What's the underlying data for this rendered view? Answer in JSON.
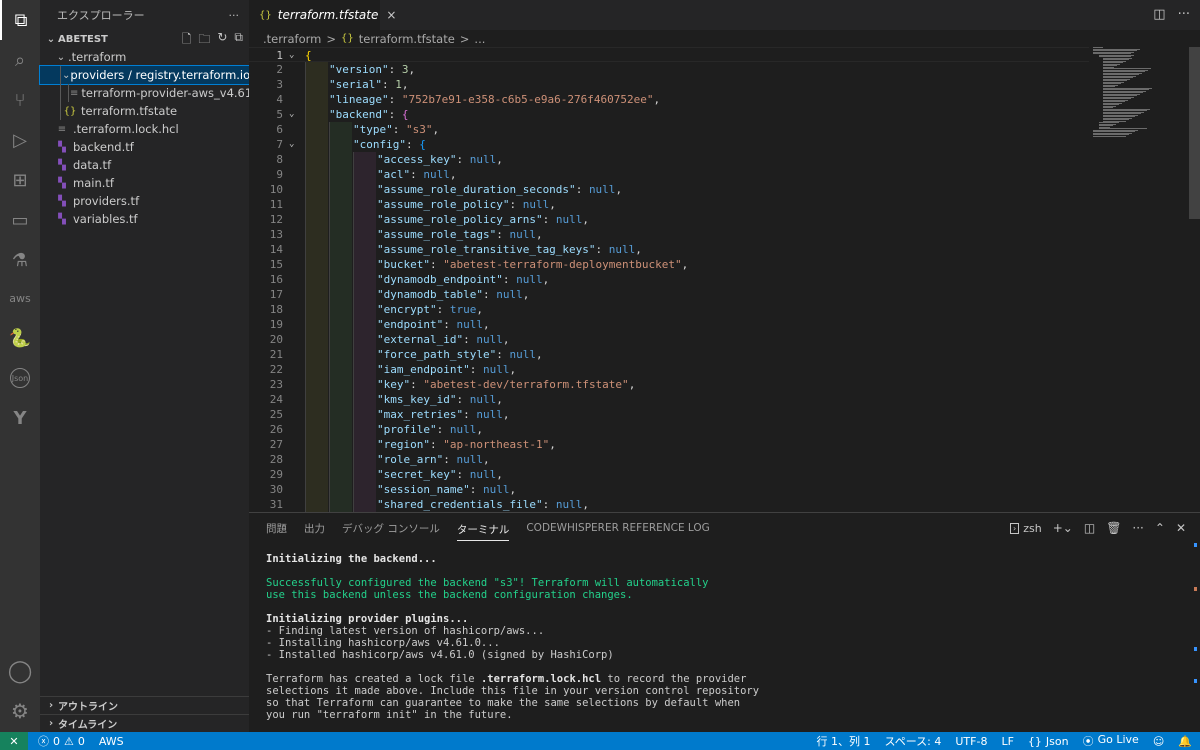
{
  "colors": {
    "accent": "#007acc",
    "activity_bar": "#333333",
    "sidebar": "#252526",
    "editor": "#1e1e1e",
    "selection": "#04395e",
    "terraform": "#844fba",
    "json_icon": "#cbcb41"
  },
  "activity_bar": {
    "items": [
      {
        "name": "explorer-icon",
        "glyph": "⧉"
      },
      {
        "name": "search-icon",
        "glyph": "⌕"
      },
      {
        "name": "source-control-icon",
        "glyph": "⑂"
      },
      {
        "name": "run-debug-icon",
        "glyph": "▷"
      },
      {
        "name": "extensions-icon",
        "glyph": "⊞"
      },
      {
        "name": "remote-explorer-icon",
        "glyph": "▭"
      },
      {
        "name": "testing-icon",
        "glyph": "⚗"
      },
      {
        "name": "aws-icon",
        "glyph": "aws"
      },
      {
        "name": "python-icon",
        "glyph": "🐍"
      },
      {
        "name": "json-icon",
        "glyph": "Json"
      },
      {
        "name": "terraform-icon",
        "glyph": "Y"
      }
    ],
    "account_icon": "◯",
    "settings_icon": "⚙"
  },
  "sidebar": {
    "title": "エクスプローラー",
    "more": "···",
    "section": "ABETEST",
    "tree": [
      {
        "label": ".terraform",
        "chev": "⌄",
        "icon": "",
        "indent": 1
      },
      {
        "label": "providers / registry.terraform.io /...",
        "chev": "⌄",
        "icon": "",
        "indent": 2,
        "selected": true
      },
      {
        "label": "terraform-provider-aws_v4.61...",
        "chev": "",
        "icon": "≡",
        "indent": 3
      },
      {
        "label": "terraform.tfstate",
        "chev": "",
        "icon": "{}",
        "indent": 2
      },
      {
        "label": ".terraform.lock.hcl",
        "chev": "",
        "icon": "≡",
        "indent": 1
      },
      {
        "label": "backend.tf",
        "chev": "",
        "icon": "tf",
        "indent": 1
      },
      {
        "label": "data.tf",
        "chev": "",
        "icon": "tf",
        "indent": 1
      },
      {
        "label": "main.tf",
        "chev": "",
        "icon": "tf",
        "indent": 1
      },
      {
        "label": "providers.tf",
        "chev": "",
        "icon": "tf",
        "indent": 1
      },
      {
        "label": "variables.tf",
        "chev": "",
        "icon": "tf",
        "indent": 1
      }
    ],
    "outline": "アウトライン",
    "timeline": "タイムライン"
  },
  "tabs": {
    "active": {
      "label": "terraform.tfstate",
      "icon": "{}",
      "close": "×"
    }
  },
  "breadcrumb": {
    "folder": ".terraform",
    "sep": ">",
    "file": "terraform.tfstate",
    "tail": "..."
  },
  "editor": {
    "lines": [
      {
        "n": "1",
        "fold": "⌄",
        "depth": 0,
        "html": "<span class='br1'>{</span>"
      },
      {
        "n": "2",
        "fold": "",
        "depth": 1,
        "html": "<span class='k'>\"version\"</span><span class='p'>: </span><span class='n'>3</span><span class='p'>,</span>"
      },
      {
        "n": "3",
        "fold": "",
        "depth": 1,
        "html": "<span class='k'>\"serial\"</span><span class='p'>: </span><span class='n'>1</span><span class='p'>,</span>"
      },
      {
        "n": "4",
        "fold": "",
        "depth": 1,
        "html": "<span class='k'>\"lineage\"</span><span class='p'>: </span><span class='s'>\"752b7e91-e358-c6b5-e9a6-276f460752ee\"</span><span class='p'>,</span>"
      },
      {
        "n": "5",
        "fold": "⌄",
        "depth": 1,
        "html": "<span class='k'>\"backend\"</span><span class='p'>: </span><span class='br2'>{</span>"
      },
      {
        "n": "6",
        "fold": "",
        "depth": 2,
        "html": "<span class='k'>\"type\"</span><span class='p'>: </span><span class='s'>\"s3\"</span><span class='p'>,</span>"
      },
      {
        "n": "7",
        "fold": "⌄",
        "depth": 2,
        "html": "<span class='k'>\"config\"</span><span class='p'>: </span><span class='br3'>{</span>"
      },
      {
        "n": "8",
        "fold": "",
        "depth": 3,
        "html": "<span class='k'>\"access_key\"</span><span class='p'>: </span><span class='b'>null</span><span class='p'>,</span>"
      },
      {
        "n": "9",
        "fold": "",
        "depth": 3,
        "html": "<span class='k'>\"acl\"</span><span class='p'>: </span><span class='b'>null</span><span class='p'>,</span>"
      },
      {
        "n": "10",
        "fold": "",
        "depth": 3,
        "html": "<span class='k'>\"assume_role_duration_seconds\"</span><span class='p'>: </span><span class='b'>null</span><span class='p'>,</span>"
      },
      {
        "n": "11",
        "fold": "",
        "depth": 3,
        "html": "<span class='k'>\"assume_role_policy\"</span><span class='p'>: </span><span class='b'>null</span><span class='p'>,</span>"
      },
      {
        "n": "12",
        "fold": "",
        "depth": 3,
        "html": "<span class='k'>\"assume_role_policy_arns\"</span><span class='p'>: </span><span class='b'>null</span><span class='p'>,</span>"
      },
      {
        "n": "13",
        "fold": "",
        "depth": 3,
        "html": "<span class='k'>\"assume_role_tags\"</span><span class='p'>: </span><span class='b'>null</span><span class='p'>,</span>"
      },
      {
        "n": "14",
        "fold": "",
        "depth": 3,
        "html": "<span class='k'>\"assume_role_transitive_tag_keys\"</span><span class='p'>: </span><span class='b'>null</span><span class='p'>,</span>"
      },
      {
        "n": "15",
        "fold": "",
        "depth": 3,
        "html": "<span class='k'>\"bucket\"</span><span class='p'>: </span><span class='s'>\"abetest-terraform-deploymentbucket\"</span><span class='p'>,</span>"
      },
      {
        "n": "16",
        "fold": "",
        "depth": 3,
        "html": "<span class='k'>\"dynamodb_endpoint\"</span><span class='p'>: </span><span class='b'>null</span><span class='p'>,</span>"
      },
      {
        "n": "17",
        "fold": "",
        "depth": 3,
        "html": "<span class='k'>\"dynamodb_table\"</span><span class='p'>: </span><span class='b'>null</span><span class='p'>,</span>"
      },
      {
        "n": "18",
        "fold": "",
        "depth": 3,
        "html": "<span class='k'>\"encrypt\"</span><span class='p'>: </span><span class='b'>true</span><span class='p'>,</span>"
      },
      {
        "n": "19",
        "fold": "",
        "depth": 3,
        "html": "<span class='k'>\"endpoint\"</span><span class='p'>: </span><span class='b'>null</span><span class='p'>,</span>"
      },
      {
        "n": "20",
        "fold": "",
        "depth": 3,
        "html": "<span class='k'>\"external_id\"</span><span class='p'>: </span><span class='b'>null</span><span class='p'>,</span>"
      },
      {
        "n": "21",
        "fold": "",
        "depth": 3,
        "html": "<span class='k'>\"force_path_style\"</span><span class='p'>: </span><span class='b'>null</span><span class='p'>,</span>"
      },
      {
        "n": "22",
        "fold": "",
        "depth": 3,
        "html": "<span class='k'>\"iam_endpoint\"</span><span class='p'>: </span><span class='b'>null</span><span class='p'>,</span>"
      },
      {
        "n": "23",
        "fold": "",
        "depth": 3,
        "html": "<span class='k'>\"key\"</span><span class='p'>: </span><span class='s'>\"abetest-dev/terraform.tfstate\"</span><span class='p'>,</span>"
      },
      {
        "n": "24",
        "fold": "",
        "depth": 3,
        "html": "<span class='k'>\"kms_key_id\"</span><span class='p'>: </span><span class='b'>null</span><span class='p'>,</span>"
      },
      {
        "n": "25",
        "fold": "",
        "depth": 3,
        "html": "<span class='k'>\"max_retries\"</span><span class='p'>: </span><span class='b'>null</span><span class='p'>,</span>"
      },
      {
        "n": "26",
        "fold": "",
        "depth": 3,
        "html": "<span class='k'>\"profile\"</span><span class='p'>: </span><span class='b'>null</span><span class='p'>,</span>"
      },
      {
        "n": "27",
        "fold": "",
        "depth": 3,
        "html": "<span class='k'>\"region\"</span><span class='p'>: </span><span class='s'>\"ap-northeast-1\"</span><span class='p'>,</span>"
      },
      {
        "n": "28",
        "fold": "",
        "depth": 3,
        "html": "<span class='k'>\"role_arn\"</span><span class='p'>: </span><span class='b'>null</span><span class='p'>,</span>"
      },
      {
        "n": "29",
        "fold": "",
        "depth": 3,
        "html": "<span class='k'>\"secret_key\"</span><span class='p'>: </span><span class='b'>null</span><span class='p'>,</span>"
      },
      {
        "n": "30",
        "fold": "",
        "depth": 3,
        "html": "<span class='k'>\"session_name\"</span><span class='p'>: </span><span class='b'>null</span><span class='p'>,</span>"
      },
      {
        "n": "31",
        "fold": "",
        "depth": 3,
        "html": "<span class='k'>\"shared_credentials_file\"</span><span class='p'>: </span><span class='b'>null</span><span class='p'>,</span>"
      }
    ]
  },
  "panel": {
    "tabs": [
      {
        "label": "問題",
        "active": false
      },
      {
        "label": "出力",
        "active": false
      },
      {
        "label": "デバッグ コンソール",
        "active": false
      },
      {
        "label": "ターミナル",
        "active": true
      },
      {
        "label": "CODEWHISPERER REFERENCE LOG",
        "active": false
      }
    ],
    "shell": "zsh",
    "terminal_lines": [
      {
        "text": "Initializing the backend...",
        "cls": "tbold"
      },
      {
        "text": "",
        "cls": ""
      },
      {
        "text": "Successfully configured the backend \"s3\"! Terraform will automatically",
        "cls": "tgreen"
      },
      {
        "text": "use this backend unless the backend configuration changes.",
        "cls": "tgreen"
      },
      {
        "text": "",
        "cls": ""
      },
      {
        "text": "Initializing provider plugins...",
        "cls": "tbold"
      },
      {
        "text": "- Finding latest version of hashicorp/aws...",
        "cls": ""
      },
      {
        "text": "- Installing hashicorp/aws v4.61.0...",
        "cls": ""
      },
      {
        "text": "- Installed hashicorp/aws v4.61.0 (signed by HashiCorp)",
        "cls": ""
      },
      {
        "text": "",
        "cls": ""
      },
      {
        "html": "Terraform has created a lock file <b style='color:#e5e5e5'>.terraform.lock.hcl</b> to record the provider",
        "cls": ""
      },
      {
        "text": "selections it made above. Include this file in your version control repository",
        "cls": ""
      },
      {
        "text": "so that Terraform can guarantee to make the same selections by default when",
        "cls": ""
      },
      {
        "text": "you run \"terraform init\" in the future.",
        "cls": ""
      }
    ]
  },
  "status": {
    "remote": "✕",
    "errors": "0",
    "warnings": "0",
    "aws": "AWS",
    "position": "行 1、列 1",
    "spaces": "スペース: 4",
    "encoding": "UTF-8",
    "eol": "LF",
    "language": "Json",
    "golive": "Go Live"
  }
}
